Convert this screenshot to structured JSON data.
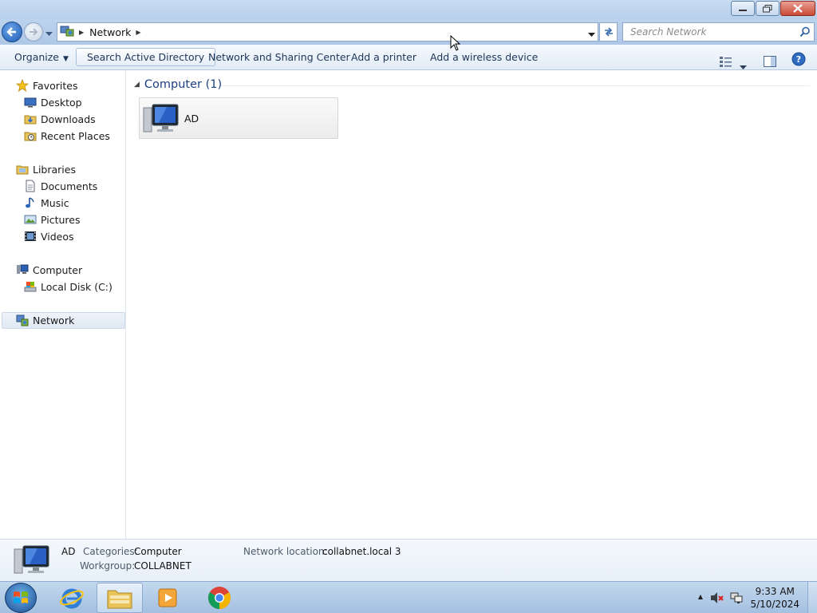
{
  "address": {
    "crumb": "Network",
    "search_placeholder": "Search Network"
  },
  "commands": {
    "organize": "Organize",
    "search_ad": "Search Active Directory",
    "sharing_center": "Network and Sharing Center",
    "add_printer": "Add a printer",
    "add_wireless": "Add a wireless device"
  },
  "nav": {
    "favorites": "Favorites",
    "desktop": "Desktop",
    "downloads": "Downloads",
    "recent": "Recent Places",
    "libraries": "Libraries",
    "documents": "Documents",
    "music": "Music",
    "pictures": "Pictures",
    "videos": "Videos",
    "computer": "Computer",
    "localdisk": "Local Disk (C:)",
    "network": "Network"
  },
  "content": {
    "group_header": "Computer (1)",
    "items": [
      {
        "name": "AD",
        "icon": "computer-icon"
      }
    ]
  },
  "details": {
    "name": "AD",
    "categories_key": "Categories:",
    "categories_val": "Computer",
    "workgroup_key": "Workgroup:",
    "workgroup_val": "COLLABNET",
    "location_key": "Network location:",
    "location_val": "collabnet.local  3"
  },
  "taskbar": {
    "time": "9:33 AM",
    "date": "5/10/2024",
    "pinned": [
      "internet-explorer-icon",
      "file-explorer-icon",
      "media-player-icon",
      "chrome-icon"
    ]
  },
  "colors": {
    "titlebar": "#b7cfea",
    "accent_text": "#1e3f80",
    "close_button": "#c94a36"
  }
}
